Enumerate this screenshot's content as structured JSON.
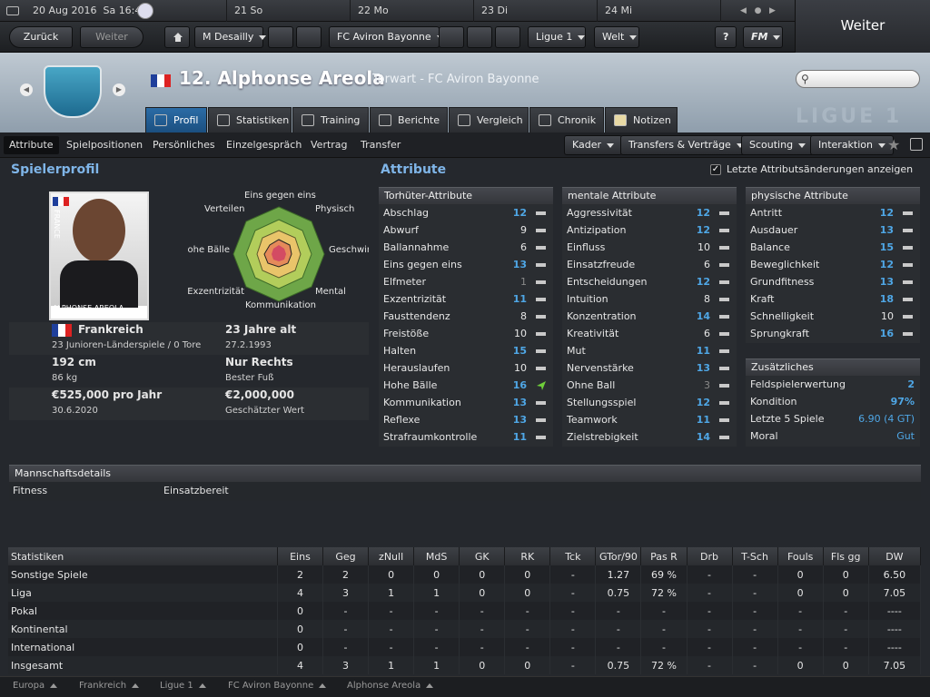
{
  "calendar": {
    "date": "20 Aug 2016",
    "time": "Sa 16:45",
    "days": [
      "21 So",
      "22 Mo",
      "23 Di",
      "24 Mi"
    ]
  },
  "top": {
    "continue_label": "Weiter"
  },
  "nav": {
    "back": "Zurück",
    "forward": "Weiter",
    "manager": "M Desailly",
    "club": "FC Aviron Bayonne",
    "league": "Ligue 1",
    "world": "Welt",
    "help": "?",
    "fm": "FM"
  },
  "player": {
    "name": "12. Alphonse Areola",
    "subtitle": "Torwart - FC Aviron Bayonne",
    "nationality_flag": "France",
    "photo_caption": "ALPHONSE AREOLA",
    "photo_flag_text": "FRANCE"
  },
  "search": {
    "placeholder": ""
  },
  "league_logo": "LIGUE 1",
  "tabs": [
    {
      "label": "Profil",
      "icon": "profile-icon"
    },
    {
      "label": "Statistiken",
      "icon": "stats-icon"
    },
    {
      "label": "Training",
      "icon": "training-icon"
    },
    {
      "label": "Berichte",
      "icon": "report-icon"
    },
    {
      "label": "Vergleich",
      "icon": "compare-icon"
    },
    {
      "label": "Chronik",
      "icon": "history-icon"
    },
    {
      "label": "Notizen",
      "icon": "notes-icon"
    }
  ],
  "subnav": [
    "Attribute",
    "Spielpositionen",
    "Persönliches",
    "Einzelgespräch",
    "Vertrag",
    "Transfer"
  ],
  "actions": [
    "Kader",
    "Transfers & Verträge",
    "Scouting",
    "Interaktion"
  ],
  "profile": {
    "title": "Spielerprofil",
    "radar_labels": [
      "Eins gegen eins",
      "Physisch",
      "Geschwindigkeit",
      "Mental",
      "Kommunikation",
      "Exzentrizität",
      "Hohe Bälle",
      "Verteilen"
    ],
    "nation": "Frankreich",
    "caps": "23 Junioren-Länderspiele / 0 Tore",
    "age": "23 Jahre alt",
    "dob": "27.2.1993",
    "height": "192 cm",
    "weight": "86 kg",
    "foot": "Nur Rechts",
    "foot_label": "Bester Fuß",
    "wage": "€525,000 pro Jahr",
    "contract_end": "30.6.2020",
    "value": "€2,000,000",
    "value_label": "Geschätzter Wert"
  },
  "attributes": {
    "title": "Attribute",
    "show_changes": "Letzte Attributsänderungen anzeigen",
    "gk": {
      "head": "Torhüter-Attribute",
      "items": [
        [
          "Abschlag",
          "12",
          "b"
        ],
        [
          "Abwurf",
          "9",
          ""
        ],
        [
          "Ballannahme",
          "6",
          ""
        ],
        [
          "Eins gegen eins",
          "13",
          "b"
        ],
        [
          "Elfmeter",
          "1",
          "g"
        ],
        [
          "Exzentrizität",
          "11",
          "b"
        ],
        [
          "Fausttendenz",
          "8",
          ""
        ],
        [
          "Freistöße",
          "10",
          ""
        ],
        [
          "Halten",
          "15",
          "b"
        ],
        [
          "Herauslaufen",
          "10",
          ""
        ],
        [
          "Hohe Bälle",
          "16",
          "b"
        ],
        [
          "Kommunikation",
          "13",
          "b"
        ],
        [
          "Reflexe",
          "13",
          "b"
        ],
        [
          "Strafraumkontrolle",
          "11",
          "b"
        ]
      ]
    },
    "mental": {
      "head": "mentale Attribute",
      "items": [
        [
          "Aggressivität",
          "12",
          "b"
        ],
        [
          "Antizipation",
          "12",
          "b"
        ],
        [
          "Einfluss",
          "10",
          ""
        ],
        [
          "Einsatzfreude",
          "6",
          ""
        ],
        [
          "Entscheidungen",
          "12",
          "b"
        ],
        [
          "Intuition",
          "8",
          ""
        ],
        [
          "Konzentration",
          "14",
          "b"
        ],
        [
          "Kreativität",
          "6",
          ""
        ],
        [
          "Mut",
          "11",
          "b"
        ],
        [
          "Nervenstärke",
          "13",
          "b"
        ],
        [
          "Ohne Ball",
          "3",
          "g"
        ],
        [
          "Stellungsspiel",
          "12",
          "b"
        ],
        [
          "Teamwork",
          "11",
          "b"
        ],
        [
          "Zielstrebigkeit",
          "14",
          "b"
        ]
      ]
    },
    "physical": {
      "head": "physische Attribute",
      "items": [
        [
          "Antritt",
          "12",
          "b"
        ],
        [
          "Ausdauer",
          "13",
          "b"
        ],
        [
          "Balance",
          "15",
          "b"
        ],
        [
          "Beweglichkeit",
          "12",
          "b"
        ],
        [
          "Grundfitness",
          "13",
          "b"
        ],
        [
          "Kraft",
          "18",
          "b"
        ],
        [
          "Schnelligkeit",
          "10",
          ""
        ],
        [
          "Sprungkraft",
          "16",
          "b"
        ]
      ]
    },
    "extra": {
      "head": "Zusätzliches",
      "items": [
        [
          "Feldspielerwertung",
          "2"
        ],
        [
          "Kondition",
          "97%"
        ],
        [
          "Letzte 5 Spiele",
          "6.90 (4 GT)"
        ],
        [
          "Moral",
          "Gut"
        ]
      ]
    }
  },
  "team": {
    "head": "Mannschaftsdetails",
    "fitness_label": "Fitness",
    "fitness_value": "Einsatzbereit"
  },
  "stats": {
    "headers": [
      "Statistiken",
      "Eins",
      "Geg",
      "zNull",
      "MdS",
      "GK",
      "RK",
      "Tck",
      "GTor/90",
      "Pas R",
      "Drb",
      "T-Sch",
      "Fouls",
      "Fls gg",
      "DW"
    ],
    "rows": [
      [
        "Sonstige Spiele",
        "2",
        "2",
        "0",
        "0",
        "0",
        "0",
        "-",
        "1.27",
        "69 %",
        "-",
        "-",
        "0",
        "0",
        "6.50"
      ],
      [
        "Liga",
        "4",
        "3",
        "1",
        "1",
        "0",
        "0",
        "-",
        "0.75",
        "72 %",
        "-",
        "-",
        "0",
        "0",
        "7.05"
      ],
      [
        "Pokal",
        "0",
        "-",
        "-",
        "-",
        "-",
        "-",
        "-",
        "-",
        "-",
        "-",
        "-",
        "-",
        "-",
        "----"
      ],
      [
        "Kontinental",
        "0",
        "-",
        "-",
        "-",
        "-",
        "-",
        "-",
        "-",
        "-",
        "-",
        "-",
        "-",
        "-",
        "----"
      ],
      [
        "International",
        "0",
        "-",
        "-",
        "-",
        "-",
        "-",
        "-",
        "-",
        "-",
        "-",
        "-",
        "-",
        "-",
        "----"
      ],
      [
        "Insgesamt",
        "4",
        "3",
        "1",
        "1",
        "0",
        "0",
        "-",
        "0.75",
        "72 %",
        "-",
        "-",
        "0",
        "0",
        "7.05"
      ]
    ]
  },
  "footer": [
    "Europa",
    "Frankreich",
    "Ligue 1",
    "FC Aviron Bayonne",
    "Alphonse Areola"
  ]
}
